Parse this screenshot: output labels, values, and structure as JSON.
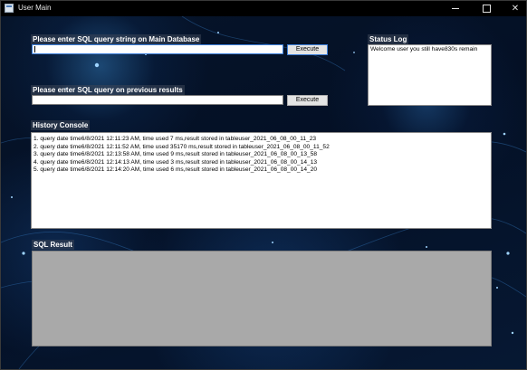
{
  "window": {
    "title": "User Main",
    "icons": {
      "app": "window-app-icon",
      "minimize": "minimize-icon",
      "maximize": "maximize-icon",
      "close": "close-icon"
    }
  },
  "main_query": {
    "label": "Please enter SQL query string on Main Database",
    "value": "",
    "button": "Execute"
  },
  "previous_query": {
    "label": "Please enter SQL query on previous results",
    "value": "",
    "button": "Execute"
  },
  "status_log": {
    "label": "Status Log",
    "text": "Welcome user you still have830s remain"
  },
  "history": {
    "label": "History Console",
    "lines": [
      "1. query date time6/8/2021 12:11:23 AM, time used 7 ms,result stored in tableuser_2021_06_08_00_11_23",
      "2. query date time6/8/2021 12:11:52 AM, time used 35170 ms,result stored in tableuser_2021_06_08_00_11_52",
      "3. query date time6/8/2021 12:13:58 AM, time used 9 ms,result stored in tableuser_2021_06_08_00_13_58",
      "4. query date time6/8/2021 12:14:13 AM, time used 3 ms,result stored in tableuser_2021_06_08_00_14_13",
      "5. query date time6/8/2021 12:14:20 AM, time used 6 ms,result stored in tableuser_2021_06_08_00_14_20"
    ]
  },
  "sql_result": {
    "label": "SQL Result"
  },
  "colors": {
    "background": "#041025",
    "label_text": "#ffffff",
    "result_panel": "#a9a9a9",
    "focus_border": "#3b7dd8"
  }
}
